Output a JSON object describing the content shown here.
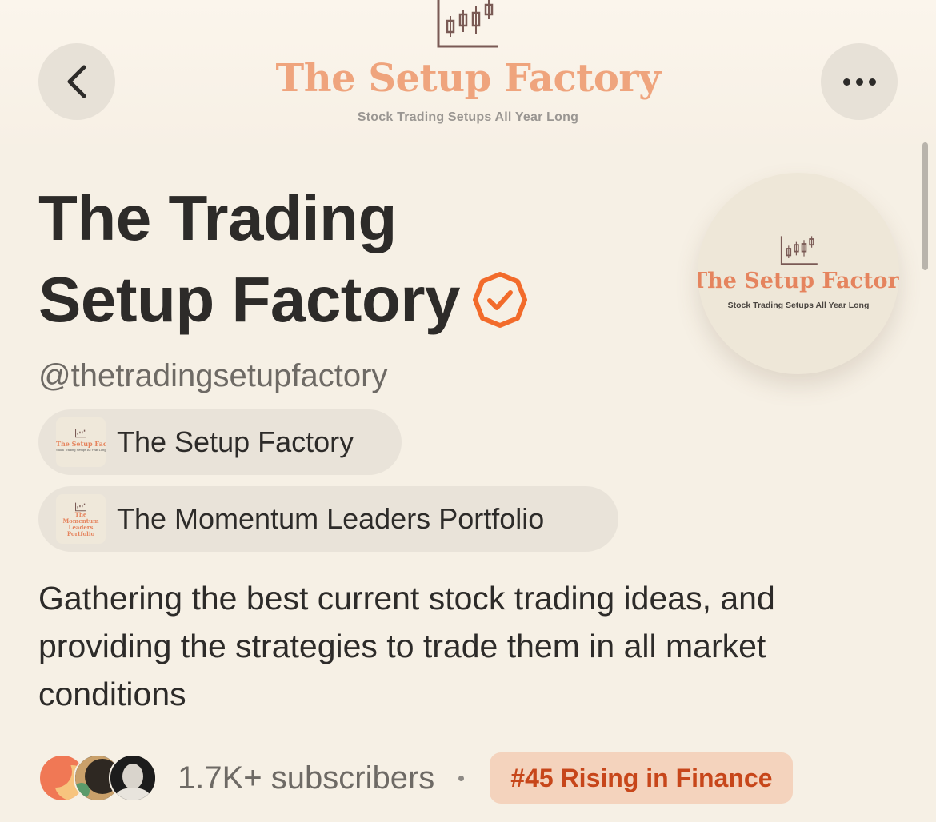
{
  "header": {
    "brand_title": "The Setup Factory",
    "brand_tagline": "Stock Trading Setups All Year Long",
    "back_icon": "chevron-left-icon",
    "more_icon": "more-horizontal-icon"
  },
  "profile": {
    "title_line1": "The Trading",
    "title_line2": "Setup Factory",
    "verified_icon": "verified-badge-icon",
    "handle": "@thetradingsetupfactory",
    "avatar_title": "The Setup Factory",
    "avatar_tagline": "Stock Trading Setups All Year Long"
  },
  "publications": [
    {
      "label": "The Setup Factory",
      "thumb_title": "The Setup Factory",
      "thumb_tagline": "Stock Trading Setups All Year Long"
    },
    {
      "label": "The Momentum Leaders Portfolio",
      "thumb_title": "The Momentum Leaders Portfolio"
    }
  ],
  "description": "Gathering the best current stock trading ideas, and providing the strategies to trade them in all market conditions",
  "stats": {
    "subscribers": "1.7K+ subscribers",
    "rank_badge": "#45 Rising in Finance"
  },
  "colors": {
    "background": "#f6f0e5",
    "brand_orange": "#efa47d",
    "verified_orange": "#f26b2b",
    "badge_bg": "#f4d3bd",
    "badge_text": "#c7461a"
  }
}
